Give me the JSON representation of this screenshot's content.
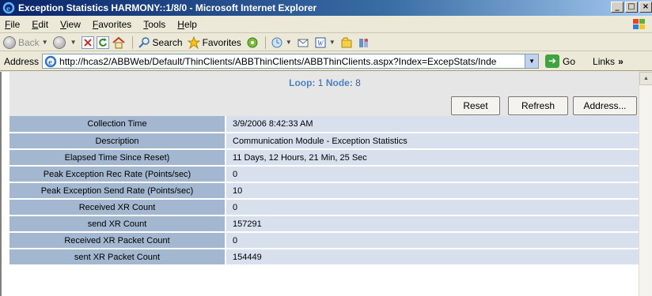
{
  "window": {
    "title": "Exception Statistics HARMONY::1/8/0 - Microsoft Internet Explorer",
    "min_glyph": "_",
    "max_glyph": "□",
    "close_glyph": "×"
  },
  "menu": {
    "items": [
      "File",
      "Edit",
      "View",
      "Favorites",
      "Tools",
      "Help"
    ]
  },
  "toolbar": {
    "back_label": "Back",
    "search_label": "Search",
    "favorites_label": "Favorites"
  },
  "address_bar": {
    "label": "Address",
    "url": "http://hcas2/ABBWeb/Default/ThinClients/ABBThinClients/ABBThinClients.aspx?Index=ExcepStats/Inde",
    "go_label": "Go",
    "links_label": "Links",
    "links_arrow": "»"
  },
  "page": {
    "loop_label": "Loop:",
    "loop_value": "1",
    "node_label": "Node:",
    "node_value": "8",
    "buttons": {
      "reset": "Reset",
      "refresh": "Refresh",
      "address": "Address..."
    },
    "rows": [
      {
        "label": "Collection Time",
        "value": "3/9/2006 8:42:33 AM"
      },
      {
        "label": "Description",
        "value": "Communication Module - Exception Statistics"
      },
      {
        "label": "Elapsed Time Since Reset)",
        "value": "11 Days, 12 Hours, 21 Min, 25 Sec"
      },
      {
        "label": "Peak Exception Rec Rate (Points/sec)",
        "value": "0"
      },
      {
        "label": "Peak Exception Send Rate (Points/sec)",
        "value": "10"
      },
      {
        "label": "Received XR Count",
        "value": "0"
      },
      {
        "label": "send XR Count",
        "value": "157291"
      },
      {
        "label": "Received XR Packet Count",
        "value": "0"
      },
      {
        "label": "sent XR Packet Count",
        "value": "154449"
      }
    ]
  }
}
